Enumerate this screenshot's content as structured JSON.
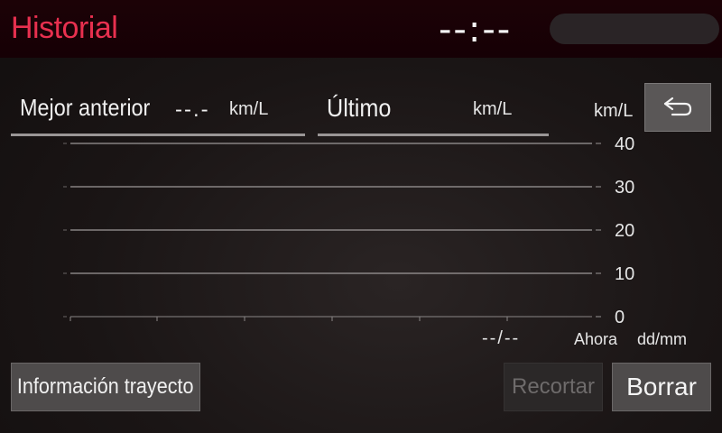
{
  "header": {
    "title": "Historial",
    "clock": "--:--"
  },
  "fields": {
    "best_previous": {
      "label": "Mejor anterior",
      "value": "--.-",
      "unit": "km/L"
    },
    "latest": {
      "label": "Último",
      "value": "",
      "unit": "km/L"
    }
  },
  "chart_data": {
    "type": "bar",
    "ylabel": "km/L",
    "xlabel": "dd/mm",
    "ylim": [
      0,
      40
    ],
    "yticks": [
      "40",
      "30",
      "20",
      "10",
      "0"
    ],
    "categories": [
      "--/--",
      "Ahora"
    ],
    "values": [],
    "grid": true
  },
  "buttons": {
    "back_icon": "back-arrow-icon",
    "trip_info": "Información trayecto",
    "trim": "Recortar",
    "clear": "Borrar"
  },
  "colors": {
    "title": "#e8304f",
    "header_bg": "#1c0206",
    "button_bg": "#4e4b4b",
    "button_disabled_text": "#6e6b6b"
  }
}
